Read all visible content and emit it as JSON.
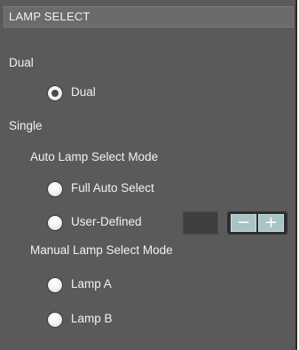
{
  "header": {
    "title": "LAMP SELECT"
  },
  "dual": {
    "section_label": "Dual",
    "option": {
      "label": "Dual",
      "checked": true
    }
  },
  "single": {
    "section_label": "Single",
    "auto_mode_label": "Auto Lamp Select Mode",
    "auto_options": [
      {
        "label": "Full Auto Select",
        "checked": false
      },
      {
        "label": "User-Defined",
        "checked": false
      }
    ],
    "user_defined_value": "",
    "stepper": {
      "minus_icon": "minus-icon",
      "plus_icon": "plus-icon",
      "minus_glyph": "−",
      "plus_glyph": "+"
    },
    "manual_mode_label": "Manual Lamp Select Mode",
    "manual_options": [
      {
        "label": "Lamp A",
        "checked": false
      },
      {
        "label": "Lamp B",
        "checked": false
      }
    ]
  },
  "colors": {
    "panel_bg": "#5a5a5a",
    "header_bg": "#6b6b6b",
    "text": "#f2f2f2",
    "stepper_button": "#a9c4c4"
  }
}
